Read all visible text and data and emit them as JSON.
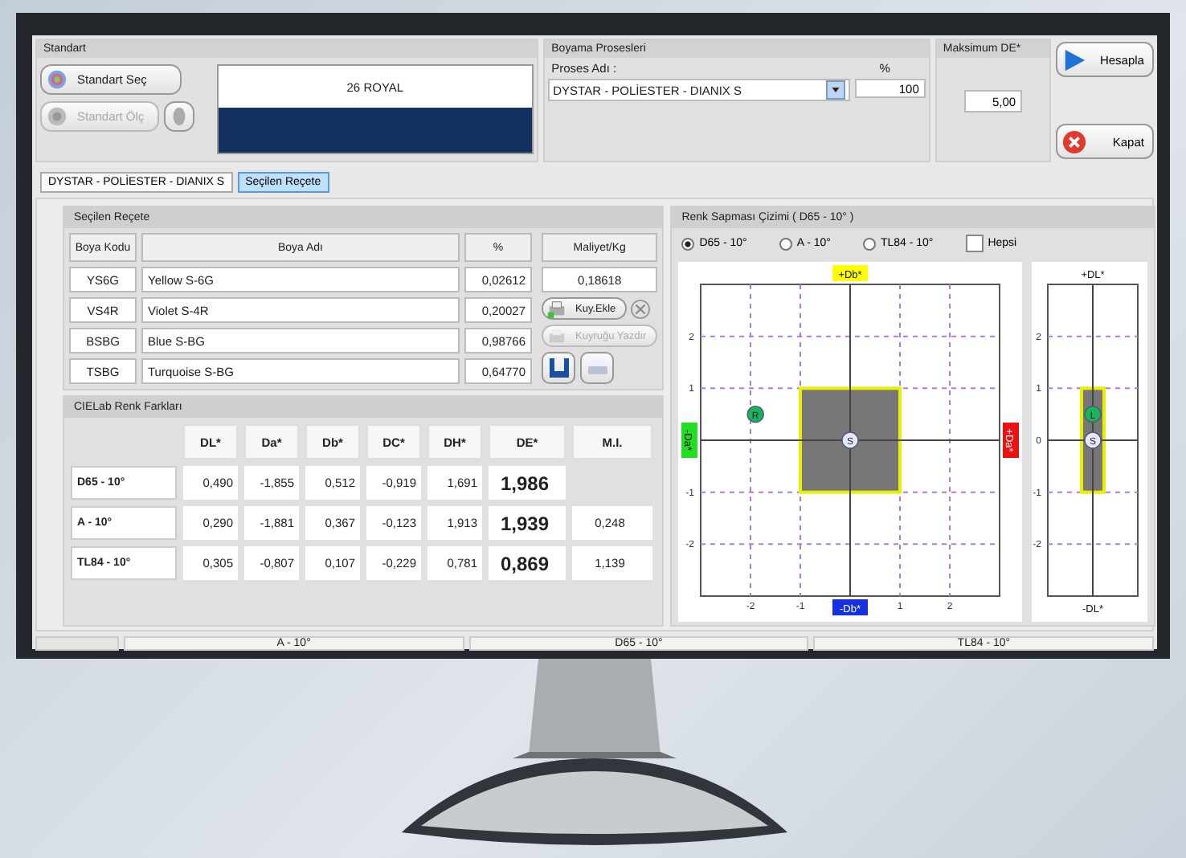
{
  "standard": {
    "title": "Standart",
    "select_button": "Standart Seç",
    "measure_button": "Standart Ölç",
    "measure_disabled": true,
    "color_name": "26 ROYAL",
    "color": "#14305f"
  },
  "process": {
    "title": "Boyama Prosesleri",
    "name_label": "Proses Adı :",
    "percent_label": "%",
    "name": "DYSTAR - POLİESTER - DIANIX S",
    "percent": "100"
  },
  "max_de": {
    "title": "Maksimum DE*",
    "value": "5,00"
  },
  "actions": [
    {
      "label": "Hesapla",
      "kind": "play"
    },
    {
      "label": "Kapat",
      "kind": "close"
    }
  ],
  "tabs": [
    {
      "label": "DYSTAR - POLİESTER - DIANIX S",
      "selected": false
    },
    {
      "label": "Seçilen Reçete",
      "selected": true
    }
  ],
  "recipe": {
    "title": "Seçilen Reçete",
    "columns": [
      "Boya Kodu",
      "Boya Adı",
      "%"
    ],
    "rows": [
      {
        "code": "YS6G",
        "name": "Yellow S-6G",
        "percent": "0,02612"
      },
      {
        "code": "VS4R",
        "name": "Violet S-4R",
        "percent": "0,20027"
      },
      {
        "code": "BSBG",
        "name": "Blue S-BG",
        "percent": "0,98766"
      },
      {
        "code": "TSBG",
        "name": "Turquoise S-BG",
        "percent": "0,64770"
      }
    ],
    "cost_label": "Maliyet/Kg",
    "cost": "0,18618",
    "add_button": "Kuy.Ekle",
    "print_queue_button": "Kuyruğu Yazdır",
    "print_queue_disabled": true
  },
  "differences": {
    "title": "CIELab Renk Farkları",
    "columns": [
      "DL*",
      "Da*",
      "Db*",
      "DC*",
      "DH*",
      "DE*",
      "M.I."
    ],
    "rows": [
      {
        "illuminant": "D65 - 10°",
        "values": [
          "0,490",
          "-1,855",
          "0,512",
          "-0,919",
          "1,691",
          "1,986"
        ]
      },
      {
        "illuminant": "A - 10°",
        "values": [
          "0,290",
          "-1,881",
          "0,367",
          "-0,123",
          "1,913",
          "1,939"
        ],
        "mi": "0,248"
      },
      {
        "illuminant": "TL84 - 10°",
        "values": [
          "0,305",
          "-0,807",
          "0,107",
          "-0,229",
          "0,781",
          "0,869"
        ],
        "mi": "1,139"
      }
    ]
  },
  "deviation": {
    "title": "Renk Sapması Çizimi ( D65 - 10° )",
    "options": [
      {
        "label": "D65 - 10°",
        "selected": true
      },
      {
        "label": "A - 10°",
        "selected": false
      },
      {
        "label": "TL84 - 10°",
        "selected": false
      }
    ],
    "all_label": "Hepsi",
    "all_checked": false,
    "charts": [
      {
        "top_label": {
          "text": "+Db*",
          "color": "#ffff00"
        },
        "bottom_label": {
          "text": "-Db*",
          "color": "#1530e0"
        },
        "left_label": {
          "text": "-Da*",
          "color": "#22dd22"
        },
        "right_label": {
          "text": "+Da*",
          "color": "#ee1111"
        },
        "chart_data": {
          "type": "scatter",
          "xlim": [
            -3,
            3
          ],
          "ylim": [
            -3,
            3
          ],
          "xticks": [
            -2,
            -1,
            1,
            2
          ],
          "yticks": [
            -2,
            -1,
            1,
            2
          ],
          "grid": true,
          "series": [
            {
              "name": "R",
              "color": "#19b35a",
              "x": [
                -1.9
              ],
              "values": [
                0.5
              ]
            },
            {
              "name": "S",
              "color": "#e4e9ff",
              "x": [
                0
              ],
              "values": [
                0
              ]
            }
          ]
        }
      },
      {
        "top_label": {
          "text": "+DL*"
        },
        "bottom_label": {
          "text": "-DL*"
        },
        "chart_data": {
          "type": "scatter",
          "categories": [
            null
          ],
          "ylim": [
            -3,
            3
          ],
          "yticks": [
            -2,
            -1,
            0,
            1,
            2
          ],
          "grid": true,
          "series": [
            {
              "name": "L",
              "color": "#19b35a",
              "values": [
                0.5
              ]
            },
            {
              "name": "S",
              "color": "#e4e9ff",
              "values": [
                0
              ]
            }
          ]
        }
      }
    ]
  },
  "bottom_tabs": [
    "A - 10°",
    "D65 - 10°",
    "TL84 - 10°"
  ]
}
